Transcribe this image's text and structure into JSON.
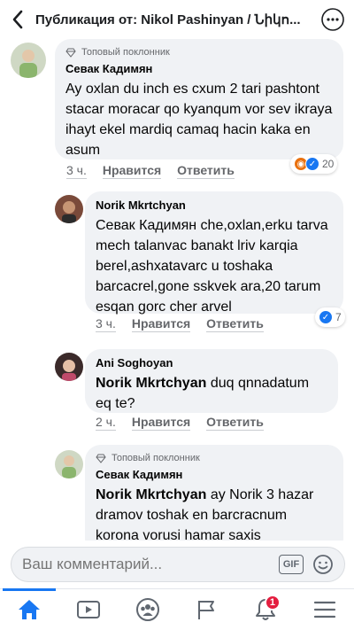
{
  "header": {
    "title": "Публикация от: Nikol Pashinyan / Նիկո..."
  },
  "comments": [
    {
      "top_fan": "Топовый поклонник",
      "author": "Севак Кадимян",
      "text": "Ay oxlan du inch es cxum 2 tari pashtont stacar moracar qo kyanqum vor sev ikraya ihayt ekel mardiq camaq hacin kaka en asum",
      "time": "3 ч.",
      "like": "Нравится",
      "reply": "Ответить",
      "reactions": {
        "count": "20",
        "icons": [
          "angry-icon",
          "like-icon"
        ]
      }
    },
    {
      "author": "Norik Mkrtchyan",
      "text": "Севак Кадимян che,oxlan,erku tarva mech talanvac banakt lriv karqia berel,ashxatavarc u toshaka barcacrel,gone sskvek ara,20 tarum esqan gorc cher arvel",
      "time": "3 ч.",
      "like": "Нравится",
      "reply": "Ответить",
      "reactions": {
        "count": "7",
        "icons": [
          "like-icon"
        ]
      }
    },
    {
      "author": "Ani Soghoyan",
      "mention": "Norik Mkrtchyan",
      "text": " duq qnnadatum eq te?",
      "time": "2 ч.",
      "like": "Нравится",
      "reply": "Ответить"
    },
    {
      "top_fan": "Топовый поклонник",
      "author": "Севак Кадимян",
      "mention": "Norik Mkrtchyan",
      "text": " ay Norik 3 hazar dramov toshak en barcracnum korona vorusi hamar saxis"
    }
  ],
  "composer": {
    "placeholder": "Ваш комментарий...",
    "gif_label": "GIF"
  },
  "tabbar": {
    "notifications_badge": "1"
  },
  "colors": {
    "accent": "#1877f2",
    "badge": "#e41e3f",
    "bubble": "#f0f2f5"
  }
}
